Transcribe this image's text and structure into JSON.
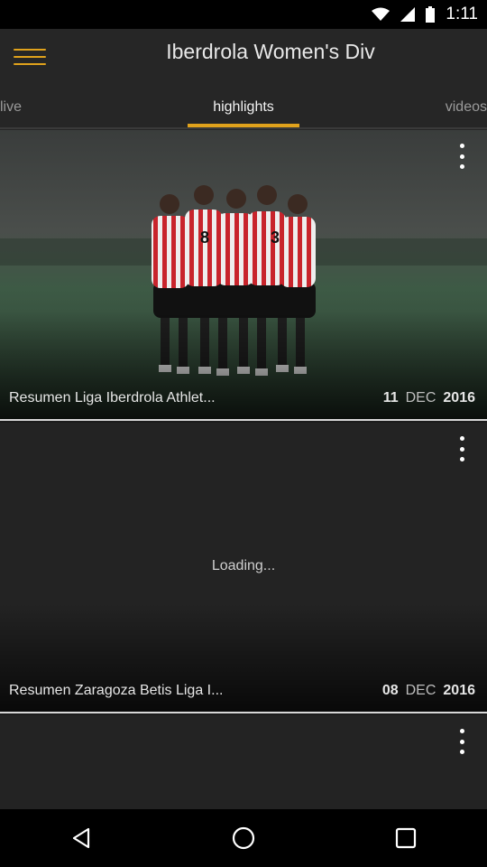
{
  "status": {
    "time": "1:11"
  },
  "header": {
    "title": "Iberdrola Women's Div"
  },
  "tabs": [
    {
      "label": "live"
    },
    {
      "label": "highlights",
      "selected": true
    },
    {
      "label": "videos"
    }
  ],
  "cards": [
    {
      "title": "Resumen Liga Iberdrola Athlet...",
      "day": "11",
      "month": "DEC",
      "year": "2016",
      "loading": ""
    },
    {
      "title": "Resumen Zaragoza Betis Liga I...",
      "day": "08",
      "month": "DEC",
      "year": "2016",
      "loading": "Loading..."
    },
    {
      "title": "",
      "day": "",
      "month": "",
      "year": "",
      "loading": ""
    }
  ],
  "colors": {
    "accent": "#e0a21c",
    "background": "#1c1c1c",
    "appbar": "#262626"
  },
  "icons": [
    "menu-icon",
    "overflow-menu-icon",
    "back-icon",
    "home-icon",
    "recents-icon",
    "wifi-icon",
    "signal-icon",
    "battery-icon"
  ]
}
